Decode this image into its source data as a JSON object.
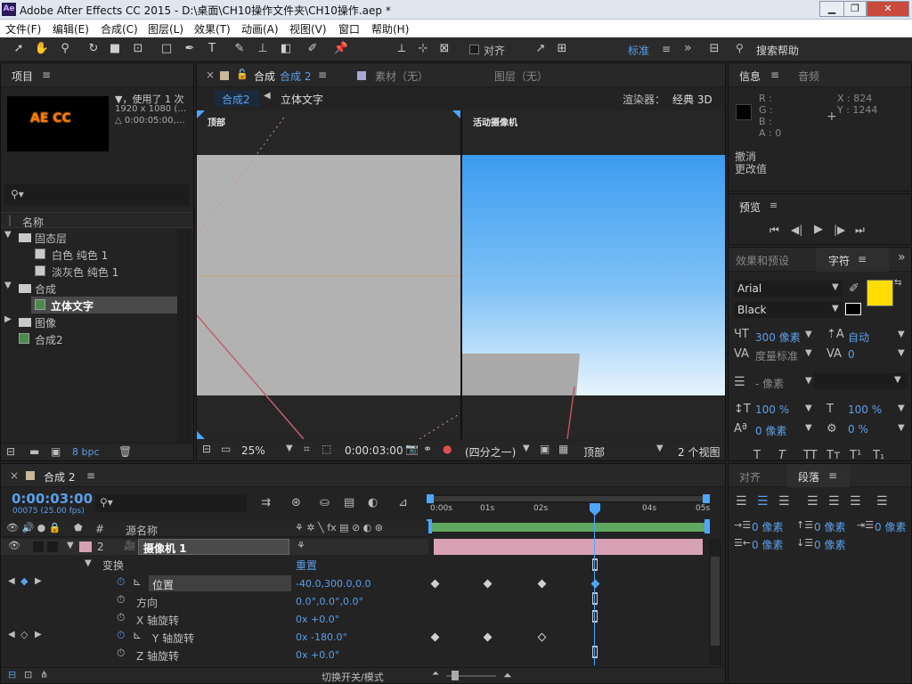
{
  "window": {
    "title": "Adobe After Effects CC 2015 - D:\\桌面\\CH10操作文件夹\\CH10操作.aep *",
    "app_logo": "Ae",
    "min": "▁",
    "max": "❐",
    "close": "✕"
  },
  "menu": [
    "文件(F)",
    "编辑(E)",
    "合成(C)",
    "图层(L)",
    "效果(T)",
    "动画(A)",
    "视图(V)",
    "窗口",
    "帮助(H)"
  ],
  "toolbar": {
    "snap_label": "对齐",
    "workspace": "标准",
    "chevron": "»",
    "search_help": "搜索帮助"
  },
  "project_panel": {
    "title": "项目",
    "thumb_text": "AE CC",
    "info_line1": "▼，使用了 1 次",
    "info_line2": "1920 x 1080  (…",
    "info_line3": "△ 0:00:05:00,…",
    "search_placeholder": "",
    "col_name": "名称",
    "tree": [
      {
        "label": "固态层",
        "type": "folder",
        "indent": 0
      },
      {
        "label": "白色 纯色 1",
        "type": "solid",
        "indent": 1
      },
      {
        "label": "淡灰色 纯色 1",
        "type": "solid",
        "indent": 1
      },
      {
        "label": "合成",
        "type": "folder",
        "indent": 0
      },
      {
        "label": "立体文字",
        "type": "comp",
        "indent": 1,
        "selected": true
      },
      {
        "label": "图像",
        "type": "folder",
        "indent": 0
      },
      {
        "label": "合成2",
        "type": "comp",
        "indent": 0
      }
    ],
    "bpc": "8 bpc"
  },
  "comp_panel": {
    "tab_comp_prefix": "合成",
    "tab_comp_name": "合成 2",
    "tab_footage": "素材（无）",
    "tab_layer": "图层（无）",
    "breadcrumb_active": "合成2",
    "breadcrumb_next": "立体文字",
    "renderer_label": "渲染器：",
    "renderer_value": "经典 3D",
    "view_left": "顶部",
    "view_right": "活动摄像机",
    "zoom": "25%",
    "timecode": "0:00:03:00",
    "resolution": "(四分之一)",
    "view_select": "顶部",
    "view_count": "2 个视图"
  },
  "info_panel": {
    "title": "信息",
    "tab_audio": "音频",
    "r": "R :",
    "g": "G :",
    "b": "B :",
    "a": "A : 0",
    "x": "X : 824",
    "y": "Y : 1244",
    "undo": "撤消",
    "change": "更改值"
  },
  "preview_panel": {
    "title": "预览"
  },
  "character_panel": {
    "tab_effects": "效果和预设",
    "tab_char": "字符",
    "font": "Arial",
    "style": "Black",
    "size": "300 像素",
    "leading": "自动",
    "kerning": "度量标准",
    "tracking": "0",
    "stroke": "- 像素",
    "vscale": "100 %",
    "hscale": "100 %",
    "baseline": "0 像素",
    "tsume": "0 %",
    "fill_color": "#ffdd00"
  },
  "align_panel": {
    "tab_align": "对齐",
    "tab_para": "段落",
    "indent_left": "0 像素",
    "indent_right": "0 像素",
    "indent_first": "0 像素",
    "space_before": "0 像素",
    "space_after": "0 像素"
  },
  "timeline": {
    "tab": "合成 2",
    "timecode": "0:00:03:00",
    "frames": "00075 (25.00 fps)",
    "col_source": "源名称",
    "layer_num": "2",
    "layer_name": "摄像机 1",
    "transform": "变换",
    "reset": "重置",
    "props": [
      {
        "name": "位置",
        "value": "-40.0,300.0,0.0",
        "stopwatch": true,
        "graph": true
      },
      {
        "name": "方向",
        "value": "0.0°,0.0°,0.0°",
        "stopwatch": false
      },
      {
        "name": "X 轴旋转",
        "value": "0x +0.0°",
        "stopwatch": false
      },
      {
        "name": "Y 轴旋转",
        "value": "0x -180.0°",
        "stopwatch": true,
        "graph": true
      },
      {
        "name": "Z 轴旋转",
        "value": "0x +0.0°",
        "stopwatch": false
      }
    ],
    "ruler": [
      "0:00s",
      "01s",
      "02s",
      "04s",
      "05s"
    ],
    "footer": "切换开关/模式"
  }
}
